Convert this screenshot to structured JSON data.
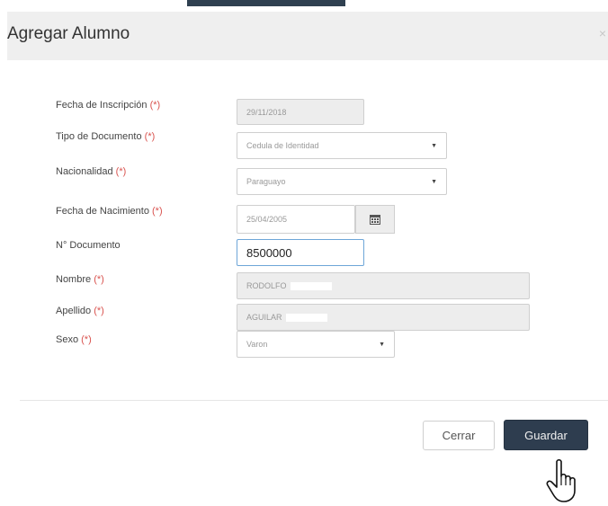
{
  "modal": {
    "title": "Agregar Alumno",
    "close_glyph": "×"
  },
  "form": {
    "required_marker": "(*)",
    "fecha_inscripcion": {
      "label": "Fecha de Inscripción",
      "value": "29/11/2018"
    },
    "tipo_documento": {
      "label": "Tipo de Documento",
      "value": "Cedula de Identidad"
    },
    "nacionalidad": {
      "label": "Nacionalidad",
      "value": "Paraguayo"
    },
    "fecha_nacimiento": {
      "label": "Fecha de Nacimiento",
      "value": "25/04/2005"
    },
    "nro_documento": {
      "label": "N° Documento",
      "value": "8500000"
    },
    "nombre": {
      "label": "Nombre",
      "value": "RODOLFO"
    },
    "apellido": {
      "label": "Apellido",
      "value": "AGUILAR"
    },
    "sexo": {
      "label": "Sexo",
      "value": "Varon"
    }
  },
  "footer": {
    "cerrar_label": "Cerrar",
    "guardar_label": "Guardar"
  },
  "colors": {
    "primary": "#2e3d4f",
    "required": "#d9534f",
    "focus_border": "#6ea6d8"
  },
  "icons": {
    "calendar": "calendar-icon",
    "dropdown": "caret-down-icon",
    "cursor": "hand-pointer-icon"
  }
}
